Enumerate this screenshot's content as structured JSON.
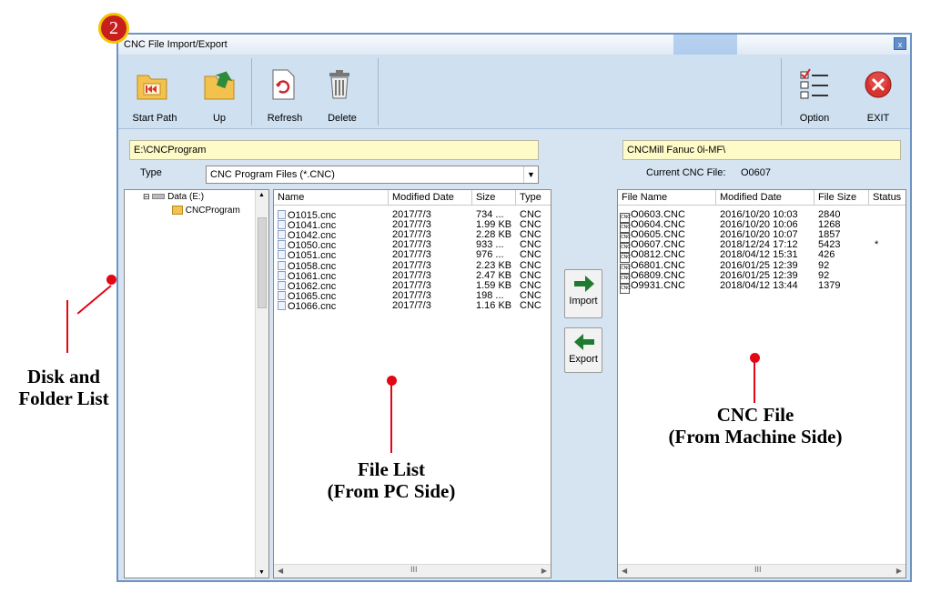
{
  "badge": "2",
  "window": {
    "title": "CNC File Import/Export",
    "close": "x"
  },
  "toolbar": {
    "start_path": "Start Path",
    "up": "Up",
    "refresh": "Refresh",
    "delete": "Delete",
    "option": "Option",
    "exit": "EXIT"
  },
  "pc": {
    "path": "E:\\CNCProgram",
    "type_label": "Type",
    "type_value": "CNC Program Files (*.CNC)"
  },
  "tree": {
    "drive": "Data (E:)",
    "folder": "CNCProgram"
  },
  "file_list": {
    "columns": [
      "Name",
      "Modified Date",
      "Size",
      "Type"
    ],
    "rows": [
      [
        "O1015.cnc",
        "2017/7/3",
        "734 ...",
        "CNC"
      ],
      [
        "O1041.cnc",
        "2017/7/3",
        "1.99 KB",
        "CNC"
      ],
      [
        "O1042.cnc",
        "2017/7/3",
        "2.28 KB",
        "CNC"
      ],
      [
        "O1050.cnc",
        "2017/7/3",
        "933 ...",
        "CNC"
      ],
      [
        "O1051.cnc",
        "2017/7/3",
        "976 ...",
        "CNC"
      ],
      [
        "O1058.cnc",
        "2017/7/3",
        "2.23 KB",
        "CNC"
      ],
      [
        "O1061.cnc",
        "2017/7/3",
        "2.47 KB",
        "CNC"
      ],
      [
        "O1062.cnc",
        "2017/7/3",
        "1.59 KB",
        "CNC"
      ],
      [
        "O1065.cnc",
        "2017/7/3",
        "198 ...",
        "CNC"
      ],
      [
        "O1066.cnc",
        "2017/7/3",
        "1.16 KB",
        "CNC"
      ]
    ]
  },
  "transfer": {
    "import": "Import",
    "export": "Export"
  },
  "machine": {
    "path": "CNCMill Fanuc 0i-MF\\",
    "current_label": "Current CNC File:",
    "current_value": "O0607",
    "columns": [
      "File Name",
      "Modified Date",
      "File Size",
      "Status"
    ],
    "rows": [
      [
        "O0603.CNC",
        "2016/10/20 10:03",
        "2840",
        ""
      ],
      [
        "O0604.CNC",
        "2016/10/20 10:06",
        "1268",
        ""
      ],
      [
        "O0605.CNC",
        "2016/10/20 10:07",
        "1857",
        ""
      ],
      [
        "O0607.CNC",
        "2018/12/24 17:12",
        "5423",
        "*"
      ],
      [
        "O0812.CNC",
        "2018/04/12 15:31",
        "426",
        ""
      ],
      [
        "O6801.CNC",
        "2016/01/25 12:39",
        "92",
        ""
      ],
      [
        "O6809.CNC",
        "2016/01/25 12:39",
        "92",
        ""
      ],
      [
        "O9931.CNC",
        "2018/04/12 13:44",
        "1379",
        ""
      ]
    ]
  },
  "annotations": {
    "disk_line1": "Disk and",
    "disk_line2": "Folder List",
    "file_line1": "File List",
    "file_line2": "(From PC Side)",
    "cnc_line1": "CNC File",
    "cnc_line2": "(From Machine Side)"
  },
  "colors": {
    "accent_red": "#e30613",
    "path_bg": "#fffbc8",
    "toolbar_bg": "#cfe0f1"
  },
  "icons": [
    "start-path-icon",
    "up-folder-icon",
    "refresh-icon",
    "delete-icon",
    "option-icon",
    "exit-icon",
    "import-arrow-icon",
    "export-arrow-icon"
  ]
}
